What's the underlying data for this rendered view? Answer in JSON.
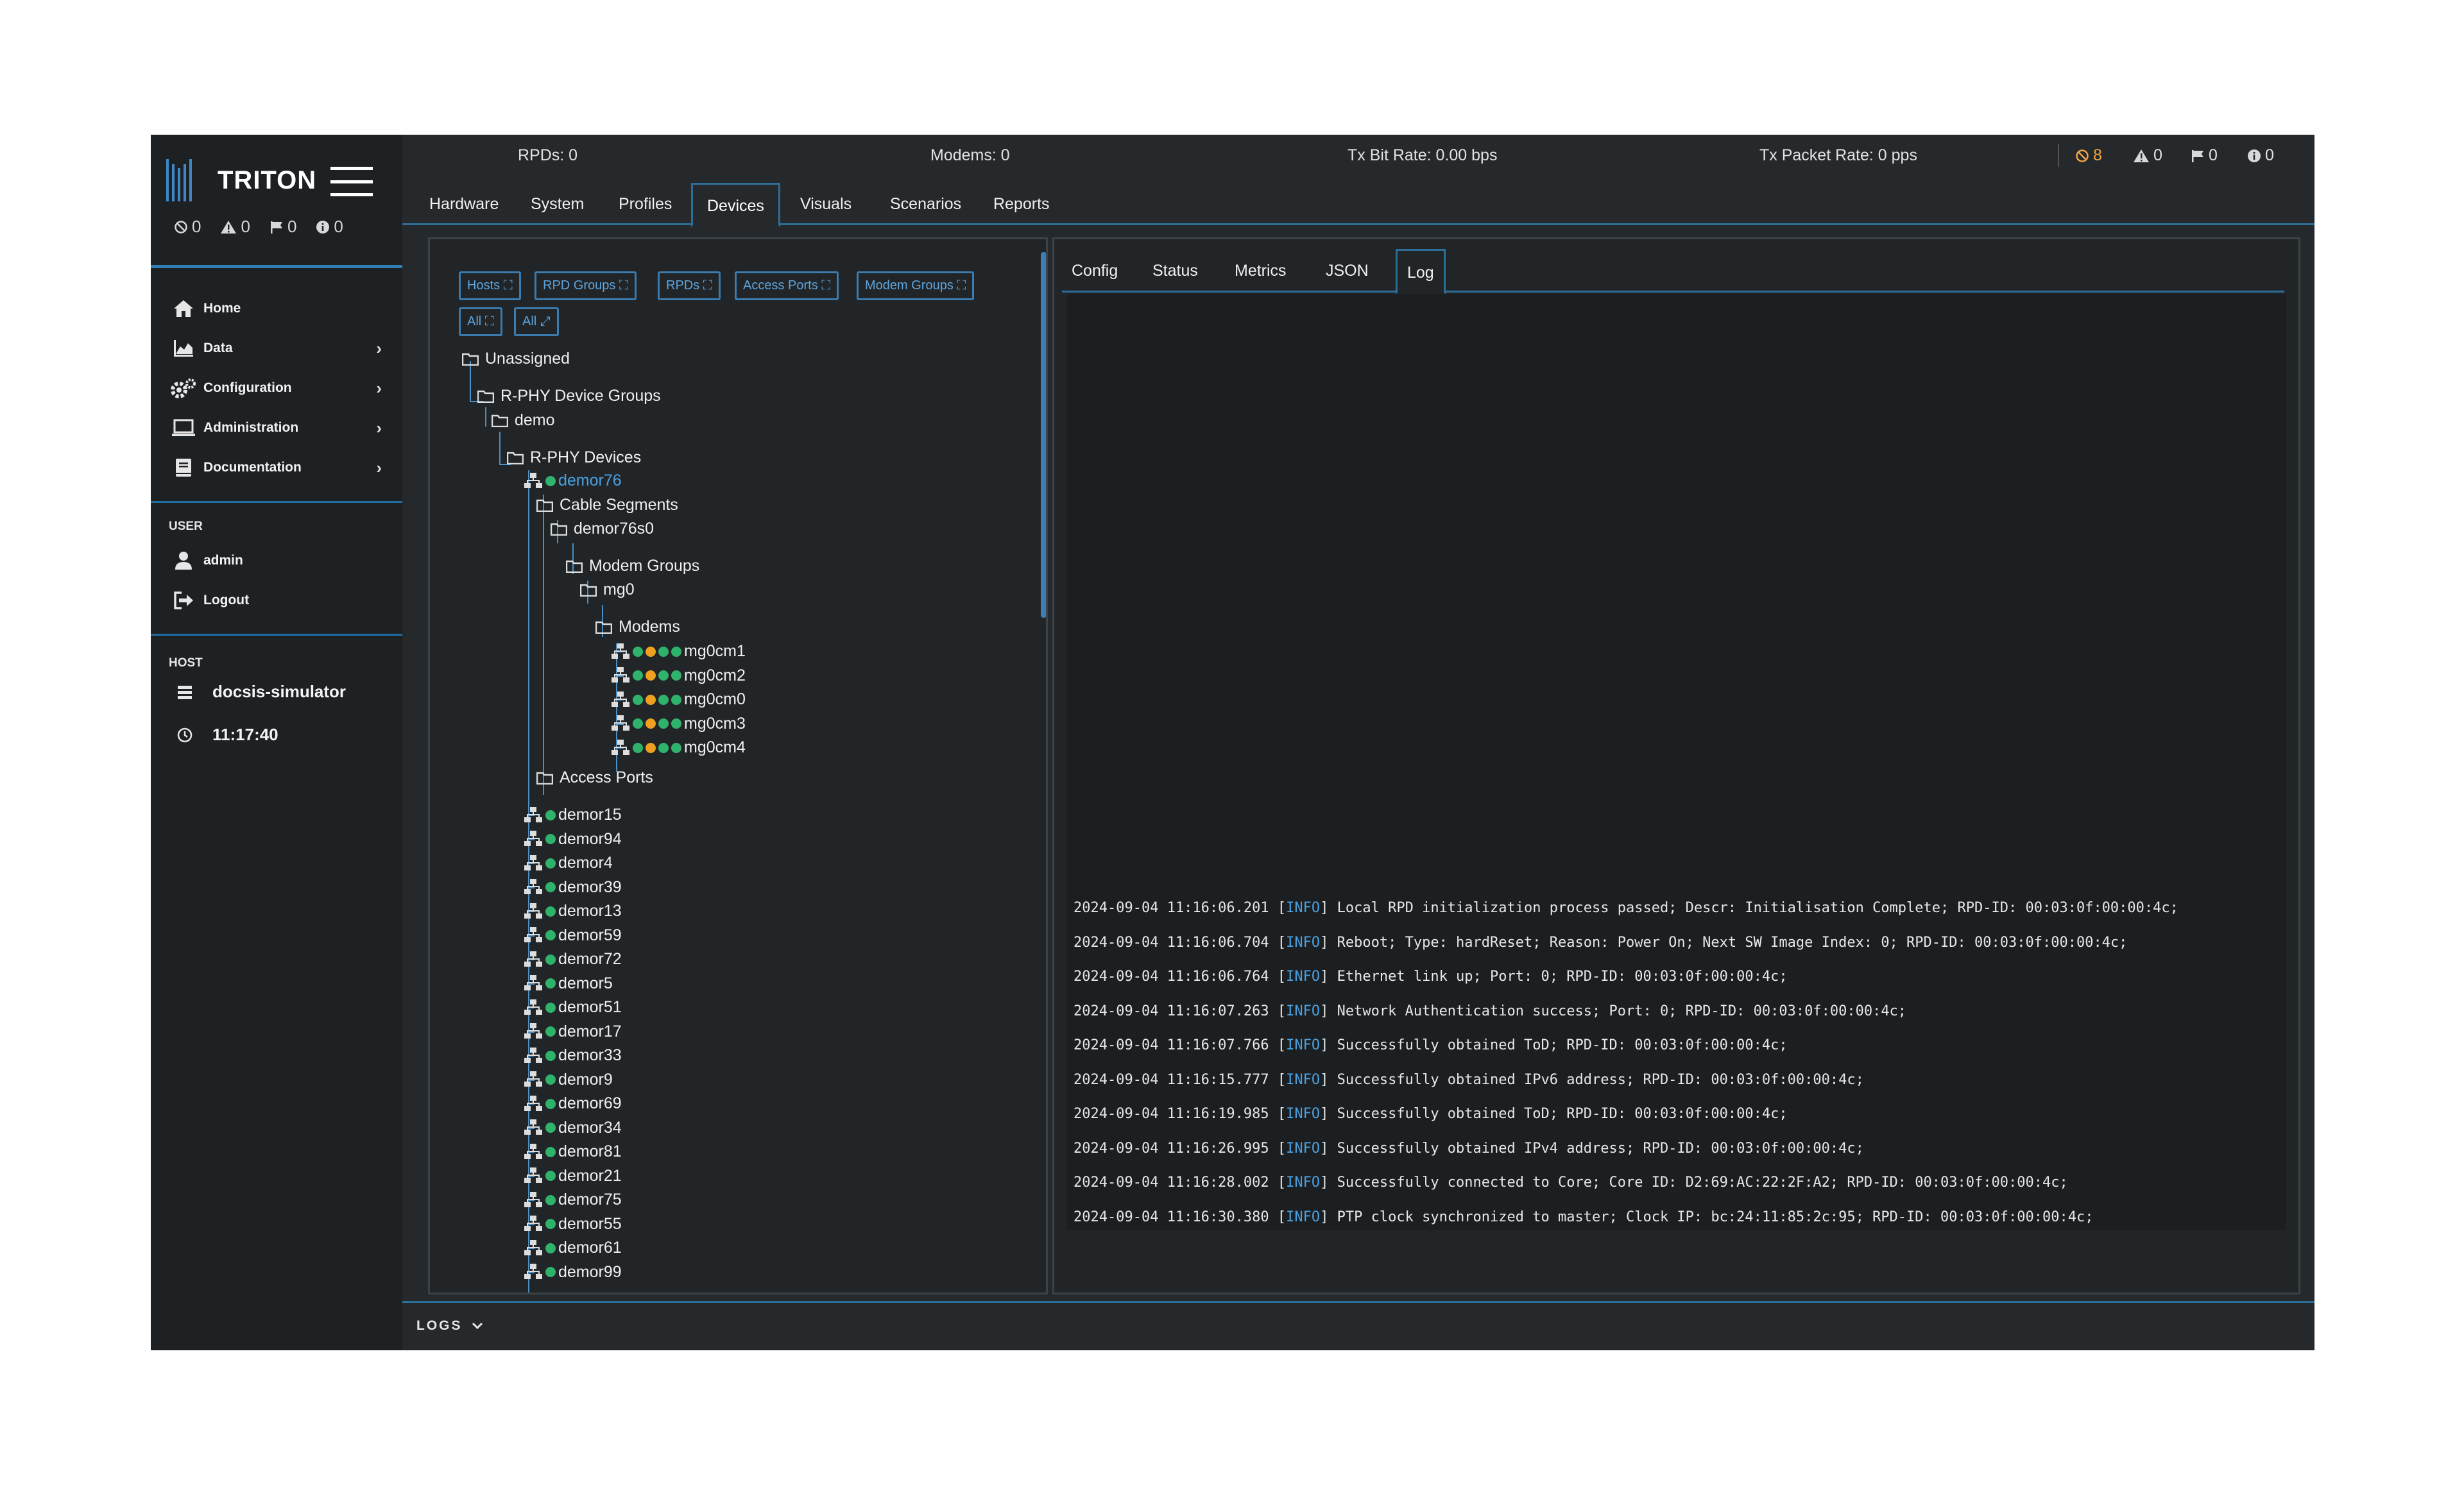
{
  "app": {
    "name": "TRITON"
  },
  "sidebar": {
    "counts": [
      {
        "icon": "ban-icon",
        "value": "0"
      },
      {
        "icon": "warning-icon",
        "value": "0"
      },
      {
        "icon": "flag-icon",
        "value": "0"
      },
      {
        "icon": "info-icon",
        "value": "0"
      }
    ],
    "nav": [
      {
        "label": "Home",
        "icon": "home-icon"
      },
      {
        "label": "Data",
        "icon": "chart-icon"
      },
      {
        "label": "Configuration",
        "icon": "gears-icon"
      },
      {
        "label": "Administration",
        "icon": "laptop-icon"
      },
      {
        "label": "Documentation",
        "icon": "book-icon"
      }
    ],
    "user_heading": "USER",
    "user": [
      {
        "label": "admin",
        "icon": "user-icon"
      },
      {
        "label": "Logout",
        "icon": "logout-icon"
      }
    ],
    "host_heading": "HOST",
    "host": {
      "name": "docsis-simulator",
      "time": "11:17:40"
    }
  },
  "topbar": {
    "rpds": "RPDs: 0",
    "modems": "Modems: 0",
    "tx_bit_rate": "Tx Bit Rate: 0.00 bps",
    "tx_packet_rate": "Tx Packet Rate: 0 pps",
    "counts": [
      {
        "icon": "ban-icon",
        "value": "8",
        "color": "#f0a64a"
      },
      {
        "icon": "warning-icon",
        "value": "0"
      },
      {
        "icon": "flag-icon",
        "value": "0"
      },
      {
        "icon": "info-icon",
        "value": "0"
      }
    ]
  },
  "tabs": [
    "Hardware",
    "System",
    "Profiles",
    "Devices",
    "Visuals",
    "Scenarios",
    "Reports"
  ],
  "active_tab": "Devices",
  "filters": [
    "Hosts",
    "RPD Groups",
    "RPDs",
    "Access Ports",
    "Modem Groups",
    "All",
    "All"
  ],
  "tree": {
    "unassigned": "Unassigned",
    "rphy_device_groups": "R-PHY Device Groups",
    "group": "demo",
    "rphy_devices": "R-PHY Devices",
    "selected_device": "demor76",
    "cable_segments": "Cable Segments",
    "segment": "demor76s0",
    "modem_groups": "Modem Groups",
    "modem_group": "mg0",
    "modems_label": "Modems",
    "modems": [
      "mg0cm1",
      "mg0cm2",
      "mg0cm0",
      "mg0cm3",
      "mg0cm4"
    ],
    "access_ports": "Access Ports",
    "devices": [
      "demor15",
      "demor94",
      "demor4",
      "demor39",
      "demor13",
      "demor59",
      "demor72",
      "demor5",
      "demor51",
      "demor17",
      "demor33",
      "demor9",
      "demor69",
      "demor34",
      "demor81",
      "demor21",
      "demor75",
      "demor55",
      "demor61",
      "demor99"
    ]
  },
  "detail_tabs": [
    "Config",
    "Status",
    "Metrics",
    "JSON",
    "Log"
  ],
  "active_detail_tab": "Log",
  "log": [
    {
      "ts": "2024-09-04 11:16:06.201",
      "level": "INFO",
      "msg": "Local RPD initialization process passed; Descr: Initialisation Complete; RPD-ID: 00:03:0f:00:00:4c;"
    },
    {
      "ts": "2024-09-04 11:16:06.704",
      "level": "INFO",
      "msg": "Reboot; Type: hardReset; Reason: Power On; Next SW Image Index: 0; RPD-ID: 00:03:0f:00:00:4c;"
    },
    {
      "ts": "2024-09-04 11:16:06.764",
      "level": "INFO",
      "msg": "Ethernet link up; Port: 0; RPD-ID: 00:03:0f:00:00:4c;"
    },
    {
      "ts": "2024-09-04 11:16:07.263",
      "level": "INFO",
      "msg": "Network Authentication success; Port: 0; RPD-ID: 00:03:0f:00:00:4c;"
    },
    {
      "ts": "2024-09-04 11:16:07.766",
      "level": "INFO",
      "msg": "Successfully obtained ToD; RPD-ID: 00:03:0f:00:00:4c;"
    },
    {
      "ts": "2024-09-04 11:16:15.777",
      "level": "INFO",
      "msg": "Successfully obtained IPv6 address; RPD-ID: 00:03:0f:00:00:4c;"
    },
    {
      "ts": "2024-09-04 11:16:19.985",
      "level": "INFO",
      "msg": "Successfully obtained ToD; RPD-ID: 00:03:0f:00:00:4c;"
    },
    {
      "ts": "2024-09-04 11:16:26.995",
      "level": "INFO",
      "msg": "Successfully obtained IPv4 address; RPD-ID: 00:03:0f:00:00:4c;"
    },
    {
      "ts": "2024-09-04 11:16:28.002",
      "level": "INFO",
      "msg": "Successfully connected to Core; Core ID: D2:69:AC:22:2F:A2; RPD-ID: 00:03:0f:00:00:4c;"
    },
    {
      "ts": "2024-09-04 11:16:30.380",
      "level": "INFO",
      "msg": "PTP clock synchronized to master; Clock IP: bc:24:11:85:2c:95; RPD-ID: 00:03:0f:00:00:4c;"
    }
  ],
  "logs_bar": {
    "label": "LOGS"
  },
  "colors": {
    "accent": "#2d6e99",
    "link": "#4aa0e0",
    "ok": "#2fb36c",
    "warn": "#f0a020"
  }
}
